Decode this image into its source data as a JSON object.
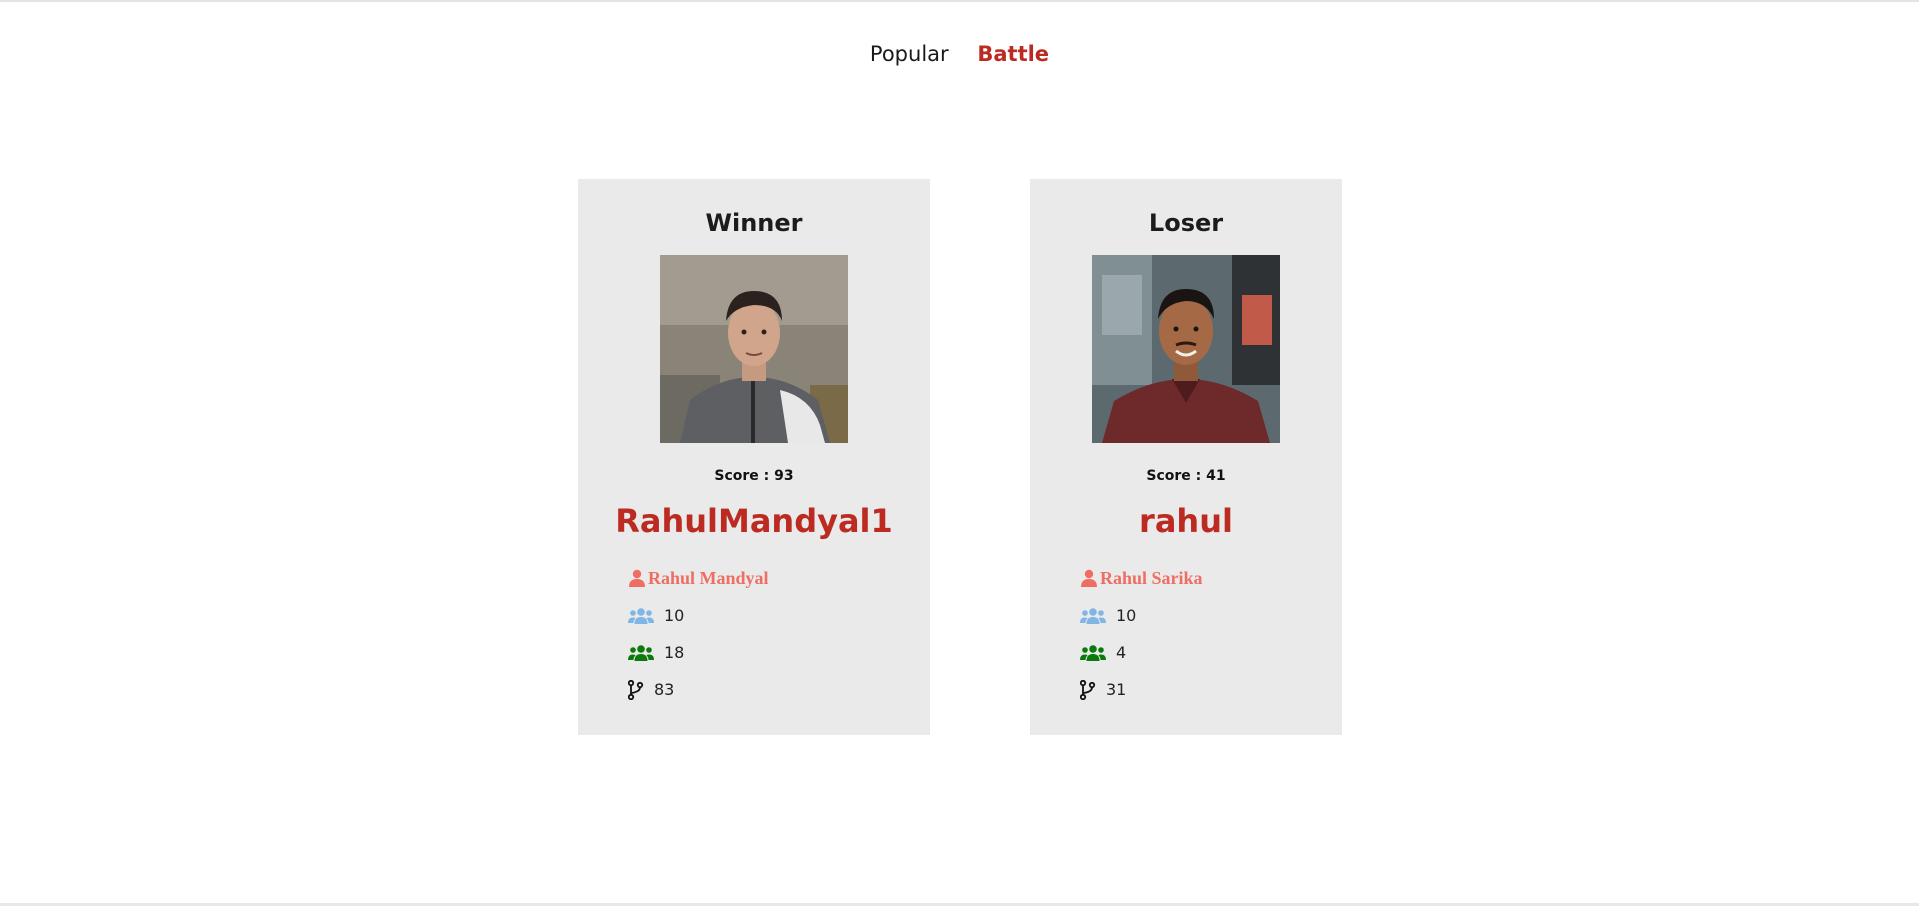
{
  "nav": {
    "items": [
      {
        "label": "Popular"
      },
      {
        "label": "Battle"
      }
    ]
  },
  "colors": {
    "accent": "#bb2b21",
    "name_color": "#ee6e63",
    "followers_icon": "#7fb6e6",
    "following_icon": "#0a7a0a",
    "card_bg": "#eaeaea"
  },
  "players": [
    {
      "result": "Winner",
      "score": "Score : 93",
      "username": "RahulMandyal1",
      "full_name": "Rahul Mandyal",
      "followers": "10",
      "following": "18",
      "repos": "83",
      "icons": {
        "name": "user-icon",
        "followers": "users-icon",
        "following": "users-icon",
        "repos": "code-branch-icon"
      }
    },
    {
      "result": "Loser",
      "score": "Score : 41",
      "username": "rahul",
      "full_name": "Rahul Sarika",
      "followers": "10",
      "following": "4",
      "repos": "31",
      "icons": {
        "name": "user-icon",
        "followers": "users-icon",
        "following": "users-icon",
        "repos": "code-branch-icon"
      }
    }
  ]
}
